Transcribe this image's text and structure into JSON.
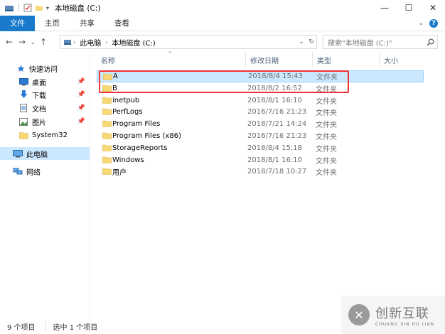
{
  "window": {
    "title": "本地磁盘 (C:)",
    "controls": [
      "—",
      "☐",
      "✕"
    ]
  },
  "ribbon": {
    "tabs": [
      "文件",
      "主页",
      "共享",
      "查看"
    ]
  },
  "address": {
    "crumbs": [
      "此电脑",
      "本地磁盘 (C:)"
    ],
    "search_placeholder": "搜索\"本地磁盘 (C:)\""
  },
  "nav": {
    "items": [
      {
        "label": "快速访问",
        "icon": "star-icon",
        "pinned": false
      },
      {
        "label": "桌面",
        "icon": "desktop-icon",
        "pinned": true
      },
      {
        "label": "下载",
        "icon": "download-icon",
        "pinned": true
      },
      {
        "label": "文档",
        "icon": "document-icon",
        "pinned": true
      },
      {
        "label": "图片",
        "icon": "pictures-icon",
        "pinned": true
      },
      {
        "label": "System32",
        "icon": "folder-icon",
        "pinned": false
      },
      {
        "label": "此电脑",
        "icon": "computer-icon",
        "pinned": false,
        "selected": true
      },
      {
        "label": "网络",
        "icon": "network-icon",
        "pinned": false
      }
    ]
  },
  "columns": {
    "name": "名称",
    "date": "修改日期",
    "type": "类型",
    "size": "大小"
  },
  "files": [
    {
      "name": "A",
      "date": "2018/8/4 15:43",
      "type": "文件夹",
      "selected": true
    },
    {
      "name": "B",
      "date": "2018/8/2 16:52",
      "type": "文件夹"
    },
    {
      "name": "inetpub",
      "date": "2018/8/1 16:10",
      "type": "文件夹"
    },
    {
      "name": "PerfLogs",
      "date": "2016/7/16 21:23",
      "type": "文件夹"
    },
    {
      "name": "Program Files",
      "date": "2018/7/21 14:24",
      "type": "文件夹"
    },
    {
      "name": "Program Files (x86)",
      "date": "2016/7/16 21:23",
      "type": "文件夹"
    },
    {
      "name": "StorageReports",
      "date": "2018/8/4 15:18",
      "type": "文件夹"
    },
    {
      "name": "Windows",
      "date": "2018/8/1 16:10",
      "type": "文件夹"
    },
    {
      "name": "用户",
      "date": "2018/7/18 10:27",
      "type": "文件夹"
    }
  ],
  "status": {
    "count": "9 个项目",
    "selected": "选中 1 个项目"
  },
  "watermark": {
    "cn": "创新互联",
    "en": "CHUANG XIN HU LIAN"
  },
  "colors": {
    "accent": "#1979ca",
    "selection": "#cce8ff",
    "folder": "#f8d775",
    "highlight": "#e33333"
  }
}
